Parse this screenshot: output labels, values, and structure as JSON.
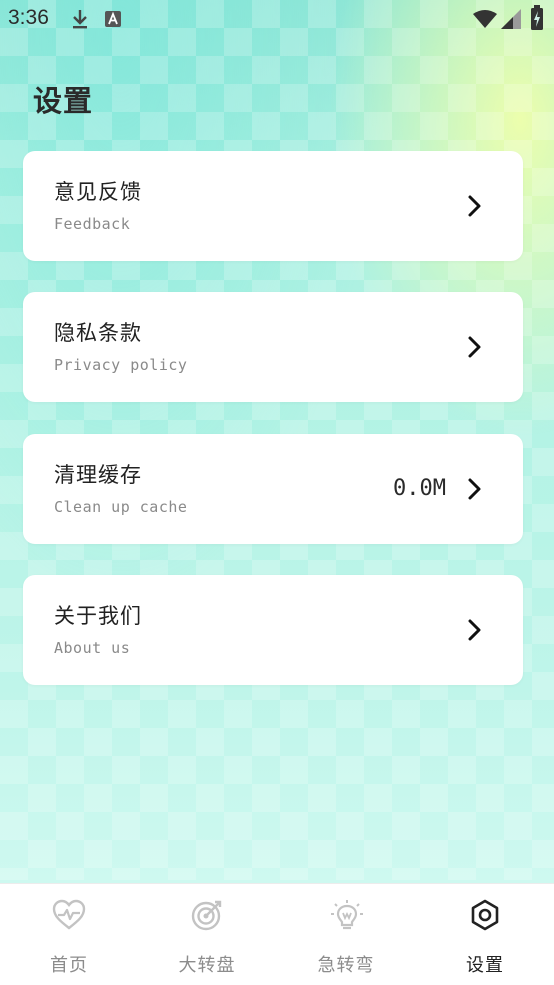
{
  "status_bar": {
    "time": "3:36",
    "icons": [
      "download-icon",
      "a-square-icon",
      "wifi-icon",
      "signal-icon",
      "battery-charging-icon"
    ]
  },
  "page": {
    "title": "设置"
  },
  "settings": [
    {
      "title": "意见反馈",
      "subtitle": "Feedback",
      "value": "",
      "icon": "chevron-right-icon"
    },
    {
      "title": "隐私条款",
      "subtitle": "Privacy policy",
      "value": "",
      "icon": "chevron-right-icon"
    },
    {
      "title": "清理缓存",
      "subtitle": "Clean up cache",
      "value": "0.0M",
      "icon": "chevron-right-icon"
    },
    {
      "title": "关于我们",
      "subtitle": "About us",
      "value": "",
      "icon": "chevron-right-icon"
    }
  ],
  "bottom_nav": [
    {
      "label": "首页",
      "icon": "heart-pulse-icon",
      "active": false
    },
    {
      "label": "大转盘",
      "icon": "target-icon",
      "active": false
    },
    {
      "label": "急转弯",
      "icon": "lightbulb-icon",
      "active": false
    },
    {
      "label": "设置",
      "icon": "settings-hexagon-icon",
      "active": true
    }
  ],
  "colors": {
    "active_nav": "#222222",
    "inactive_nav": "#8c8c8c",
    "card_bg": "#ffffff",
    "background_teal": "#aef1e2",
    "background_highlight": "#f0ffaa"
  }
}
